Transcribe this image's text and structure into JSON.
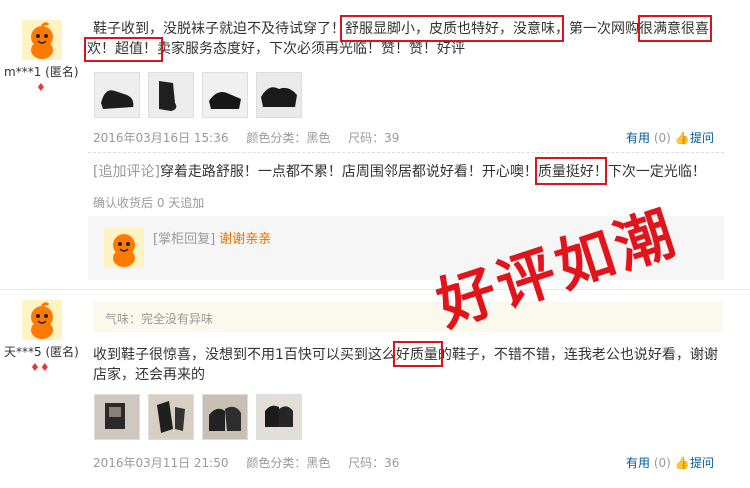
{
  "review1": {
    "username": "m***1 (匿名)",
    "text_line1": "鞋子收到，没脱袜子就迫不及待试穿了！舒服显脚小，皮质也特好，没意味，第一次网购很满意很喜",
    "text_line2": "欢！超值！卖家服务态度好，下次必须再光临！赞！赞！好评",
    "date": "2016年03月16日 15:36",
    "color_label": "颜色分类：黑色",
    "size_label": "尺码：39",
    "useful_label": "有用",
    "useful_count": "(0)",
    "ask_label": "提问",
    "followup_tag": "[追加评论]",
    "followup_text": "穿着走路舒服！一点都不累！店周围邻居都说好看！开心噢！质量挺好！下次一定光临！",
    "followup_note": "确认收货后 0 天追加",
    "reply_tag": "[掌柜回复]",
    "reply_text": "谢谢亲亲"
  },
  "review2": {
    "username": "天***5 (匿名)",
    "smell_text": "气味：完全没有异味",
    "text_line1": "收到鞋子很惊喜，没想到不用1百快可以买到这么好质量的鞋子，不错不错，连我老公也说好看，谢谢",
    "text_line2": "店家，还会再来的",
    "date": "2016年03月11日 21:50",
    "color_label": "颜色分类：黑色",
    "size_label": "尺码：36",
    "useful_label": "有用",
    "useful_count": "(0)",
    "ask_label": "提问"
  },
  "stamp_text": "好评如潮",
  "colors": {
    "accent_red": "#d9141c",
    "link_blue": "#005aa0",
    "reply_orange": "#e57200"
  }
}
